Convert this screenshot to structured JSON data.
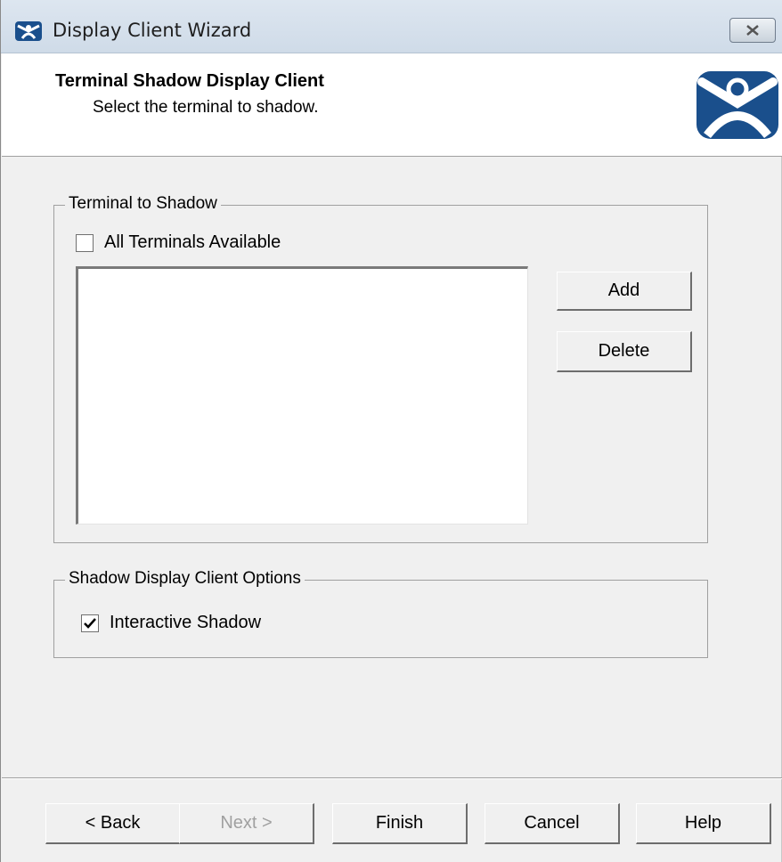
{
  "window": {
    "title": "Display Client Wizard",
    "close_icon": "close-icon"
  },
  "header": {
    "title": "Terminal Shadow Display Client",
    "subtitle": "Select the terminal to shadow.",
    "logo_icon": "thinmanager-logo-icon",
    "logo_color": "#1a4f8c"
  },
  "terminal_group": {
    "legend": "Terminal to Shadow",
    "all_terminals_checkbox": {
      "label": "All Terminals Available",
      "checked": false
    },
    "terminal_list": [],
    "add_label": "Add",
    "delete_label": "Delete"
  },
  "options_group": {
    "legend": "Shadow Display Client Options",
    "interactive_shadow_checkbox": {
      "label": "Interactive Shadow",
      "checked": true
    }
  },
  "footer": {
    "back_label": "< Back",
    "next_label": "Next >",
    "next_enabled": false,
    "finish_label": "Finish",
    "cancel_label": "Cancel",
    "help_label": "Help"
  }
}
